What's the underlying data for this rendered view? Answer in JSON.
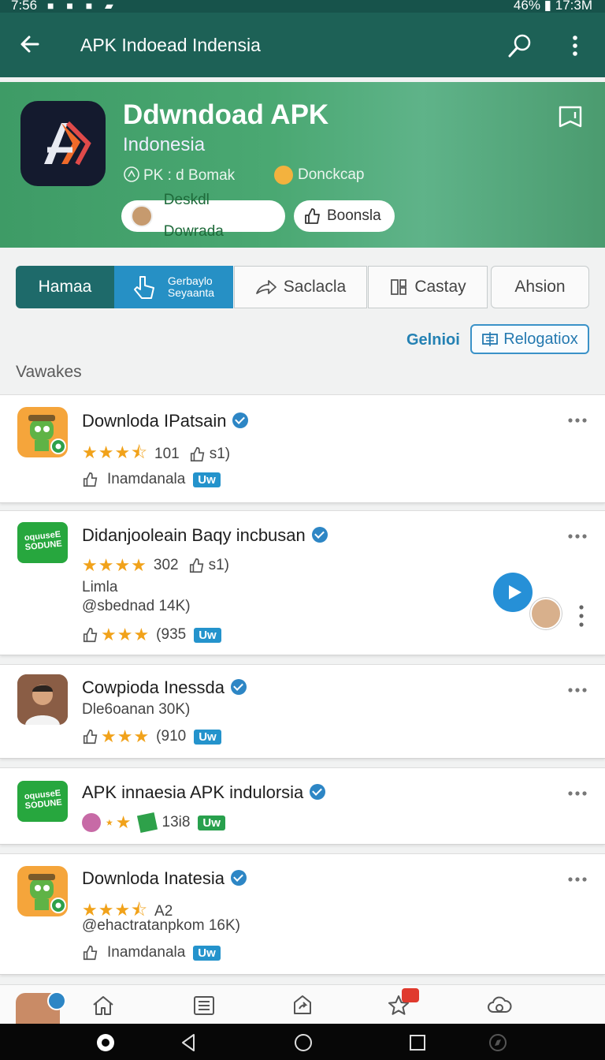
{
  "status_bar": {
    "time": "7:56",
    "battery": "46%",
    "clock_right": "17:3M"
  },
  "app_bar": {
    "title": "APK Indoead Indensia"
  },
  "hero": {
    "title": "Ddwndoad APK",
    "subtitle": "Indonesia",
    "meta_left": "PK : d Bomak",
    "meta_right": "Donckcap",
    "primary_pill": "Deskdl Dowrada",
    "secondary_pill": "Boonsla"
  },
  "tabs": [
    {
      "label": "Hamaa"
    },
    {
      "label_line1": "Gerbaylo",
      "label_line2": "Seyaanta"
    },
    {
      "label": "Saclacla"
    },
    {
      "label": "Castay"
    },
    {
      "label": "Ahsion"
    }
  ],
  "filters": {
    "link": "Gelnioi",
    "button": "Relogatiox"
  },
  "section_title": "Vawakes",
  "apps": [
    {
      "title": "Downloda IPatsain",
      "rating_text": "101",
      "likes": "s1)",
      "author": "Inamdanala",
      "badge": "Uw"
    },
    {
      "title": "Didanjooleain Baqy incbusan",
      "rating_text": "302",
      "likes": "s1)",
      "line2": "Limla",
      "line3": "@sbednad 14K)",
      "rating_text2": "(935",
      "badge": "Uw"
    },
    {
      "title": "Cowpioda Inessda",
      "line2": "Dle6oanan 30K)",
      "rating_text": "(910",
      "badge": "Uw"
    },
    {
      "title": "APK innaesia APK indulorsia",
      "rating_text": "13i8",
      "badge": "Uw"
    },
    {
      "title": "Downloda Inatesia",
      "rating_text": "A2",
      "line2": "@ehactratanpkom 16K)",
      "author": "Inamdanala",
      "badge": "Uw"
    }
  ],
  "icon_text": {
    "green_logo_line1": "oquuseE",
    "green_logo_line2": "SODUNE"
  },
  "colors": {
    "app_bar": "#1d6156",
    "hero": "#4aa872",
    "accent_blue": "#2690c5",
    "star": "#f1a21a"
  }
}
